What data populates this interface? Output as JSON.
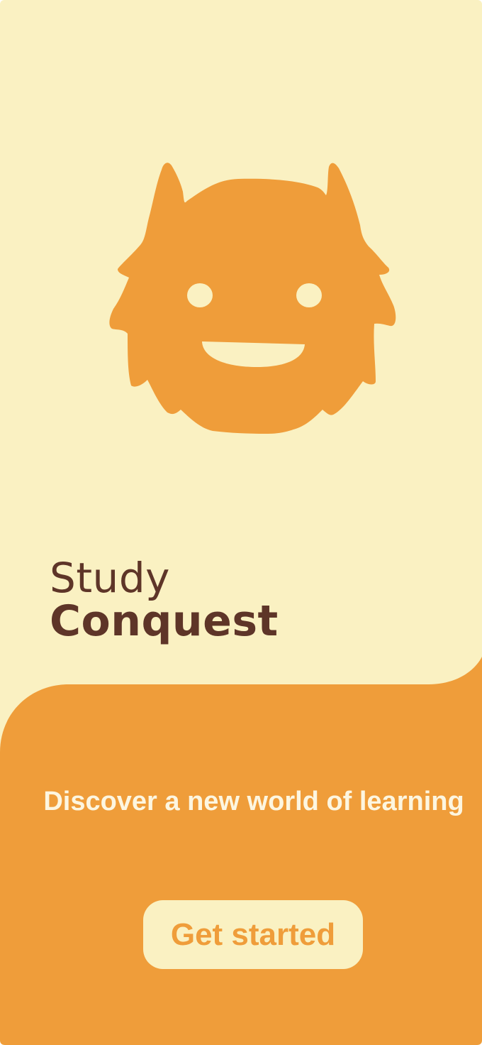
{
  "colors": {
    "background": "#FAF1C2",
    "accent": "#EF9D3A",
    "title_text": "#5E3528",
    "tagline_text": "#FDF6E0",
    "button_text": "#EF9D3A"
  },
  "mascot": {
    "icon": "monster-mascot-icon"
  },
  "app_title": {
    "line1": "Study",
    "line2": "Conquest"
  },
  "onboarding": {
    "tagline": "Discover a new world of learning",
    "cta_label": "Get started"
  }
}
